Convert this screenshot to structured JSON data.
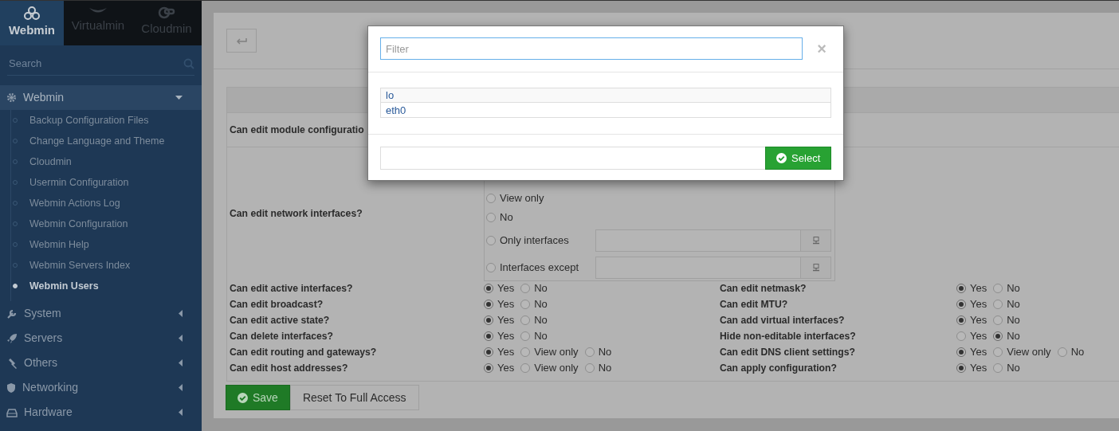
{
  "sidebar": {
    "product_tabs": [
      {
        "label": "Webmin",
        "selected": true
      },
      {
        "label": "Virtualmin",
        "selected": false
      },
      {
        "label": "Cloudmin",
        "selected": false
      }
    ],
    "search": {
      "placeholder": "Search"
    },
    "categories": [
      {
        "label": "Webmin",
        "expanded": true,
        "children": [
          {
            "label": "Backup Configuration Files",
            "selected": false
          },
          {
            "label": "Change Language and Theme",
            "selected": false
          },
          {
            "label": "Cloudmin",
            "selected": false
          },
          {
            "label": "Usermin Configuration",
            "selected": false
          },
          {
            "label": "Webmin Actions Log",
            "selected": false
          },
          {
            "label": "Webmin Configuration",
            "selected": false
          },
          {
            "label": "Webmin Help",
            "selected": false
          },
          {
            "label": "Webmin Servers Index",
            "selected": false
          },
          {
            "label": "Webmin Users",
            "selected": true
          }
        ]
      },
      {
        "label": "System",
        "expanded": false
      },
      {
        "label": "Servers",
        "expanded": false
      },
      {
        "label": "Others",
        "expanded": false
      },
      {
        "label": "Networking",
        "expanded": false
      },
      {
        "label": "Hardware",
        "expanded": false
      }
    ]
  },
  "form": {
    "module_config": {
      "label": "Can edit module configuratio"
    },
    "network_interfaces": {
      "label": "Can edit network interfaces?",
      "options": [
        {
          "label": "View only",
          "selected": false,
          "kind": "plain"
        },
        {
          "label": "No",
          "selected": false,
          "kind": "plain"
        },
        {
          "label": "Only interfaces",
          "selected": false,
          "kind": "list"
        },
        {
          "label": "Interfaces except",
          "selected": false,
          "kind": "list"
        }
      ]
    },
    "rows": [
      {
        "left": {
          "label": "Can edit active interfaces?",
          "options": [
            {
              "label": "Yes",
              "selected": true
            },
            {
              "label": "No",
              "selected": false
            }
          ]
        },
        "right": {
          "label": "Can edit netmask?",
          "options": [
            {
              "label": "Yes",
              "selected": true
            },
            {
              "label": "No",
              "selected": false
            }
          ]
        }
      },
      {
        "left": {
          "label": "Can edit broadcast?",
          "options": [
            {
              "label": "Yes",
              "selected": true
            },
            {
              "label": "No",
              "selected": false
            }
          ]
        },
        "right": {
          "label": "Can edit MTU?",
          "options": [
            {
              "label": "Yes",
              "selected": true
            },
            {
              "label": "No",
              "selected": false
            }
          ]
        }
      },
      {
        "left": {
          "label": "Can edit active state?",
          "options": [
            {
              "label": "Yes",
              "selected": true
            },
            {
              "label": "No",
              "selected": false
            }
          ]
        },
        "right": {
          "label": "Can add virtual interfaces?",
          "options": [
            {
              "label": "Yes",
              "selected": true
            },
            {
              "label": "No",
              "selected": false
            }
          ]
        }
      },
      {
        "left": {
          "label": "Can delete interfaces?",
          "options": [
            {
              "label": "Yes",
              "selected": true
            },
            {
              "label": "No",
              "selected": false
            }
          ]
        },
        "right": {
          "label": "Hide non-editable interfaces?",
          "options": [
            {
              "label": "Yes",
              "selected": false
            },
            {
              "label": "No",
              "selected": true
            }
          ]
        }
      },
      {
        "left": {
          "label": "Can edit routing and gateways?",
          "options": [
            {
              "label": "Yes",
              "selected": true
            },
            {
              "label": "View only",
              "selected": false
            },
            {
              "label": "No",
              "selected": false
            }
          ]
        },
        "right": {
          "label": "Can edit DNS client settings?",
          "options": [
            {
              "label": "Yes",
              "selected": true
            },
            {
              "label": "View only",
              "selected": false
            },
            {
              "label": "No",
              "selected": false
            }
          ]
        }
      },
      {
        "left": {
          "label": "Can edit host addresses?",
          "options": [
            {
              "label": "Yes",
              "selected": true
            },
            {
              "label": "View only",
              "selected": false
            },
            {
              "label": "No",
              "selected": false
            }
          ]
        },
        "right": {
          "label": "Can apply configuration?",
          "options": [
            {
              "label": "Yes",
              "selected": true
            },
            {
              "label": "No",
              "selected": false
            }
          ]
        }
      }
    ]
  },
  "buttons": [
    {
      "label": "Save",
      "kind": "primary"
    },
    {
      "label": "Reset To Full Access",
      "kind": "plain"
    }
  ],
  "modal": {
    "filter": {
      "placeholder": "Filter"
    },
    "close": "×",
    "items": [
      {
        "label": "lo"
      },
      {
        "label": "eth0"
      }
    ],
    "select_button": "Select"
  }
}
